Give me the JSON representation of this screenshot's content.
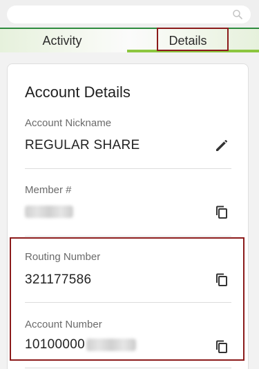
{
  "search": {
    "placeholder": "",
    "icon": "search-icon"
  },
  "tabs": [
    {
      "label": "Activity",
      "active": false
    },
    {
      "label": "Details",
      "active": true
    }
  ],
  "colors": {
    "accent": "#8cc63f",
    "brand_green": "#2e8b3e",
    "highlight": "#8b1a1a"
  },
  "card": {
    "title": "Account Details",
    "fields": [
      {
        "label": "Account Nickname",
        "value": "REGULAR SHARE",
        "action_icon": "pencil-icon"
      },
      {
        "label": "Member #",
        "value": "",
        "redacted": true,
        "action_icon": "copy-icon"
      },
      {
        "label": "Routing Number",
        "value": "321177586",
        "action_icon": "copy-icon"
      },
      {
        "label": "Account Number",
        "value": "10100000",
        "redacted_suffix": true,
        "action_icon": "copy-icon"
      }
    ]
  }
}
